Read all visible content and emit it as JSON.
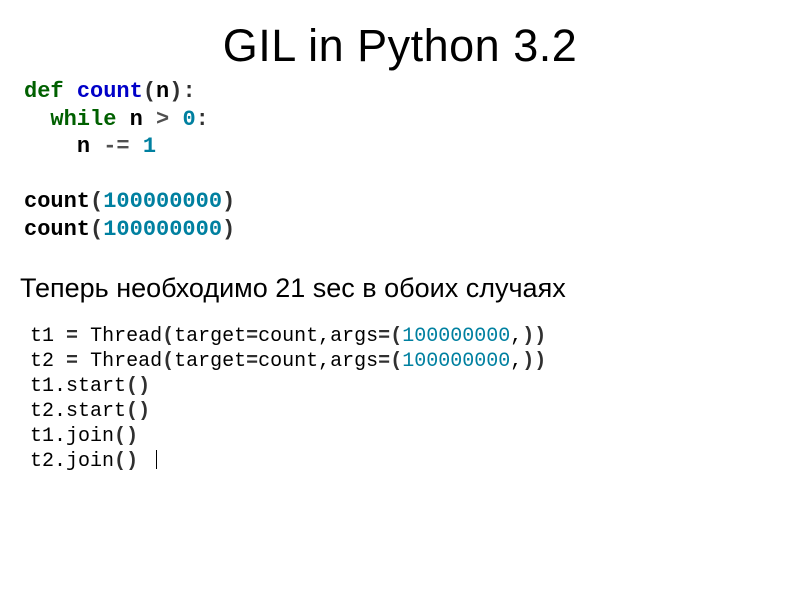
{
  "title": "GIL in Python 3.2",
  "code1": {
    "kw_def": "def",
    "fn_count": "count",
    "paren_open": "(",
    "param_n": "n",
    "paren_close": ")",
    "colon": ":",
    "kw_while": "while",
    "id_n": "n",
    "op_gt": ">",
    "num_zero": "0",
    "op_minuseq": "-=",
    "num_one": "1",
    "call_count": "count",
    "num_big": "100000000"
  },
  "caption": "Теперь необходимо 21 sec в обоих случаях",
  "code2": {
    "t1": "t1",
    "t2": "t2",
    "eq": "=",
    "Thread": "Thread",
    "target_eq": "target",
    "count": "count",
    "args_eq": "args",
    "num_big": "100000000",
    "start": "start",
    "join": "join"
  }
}
